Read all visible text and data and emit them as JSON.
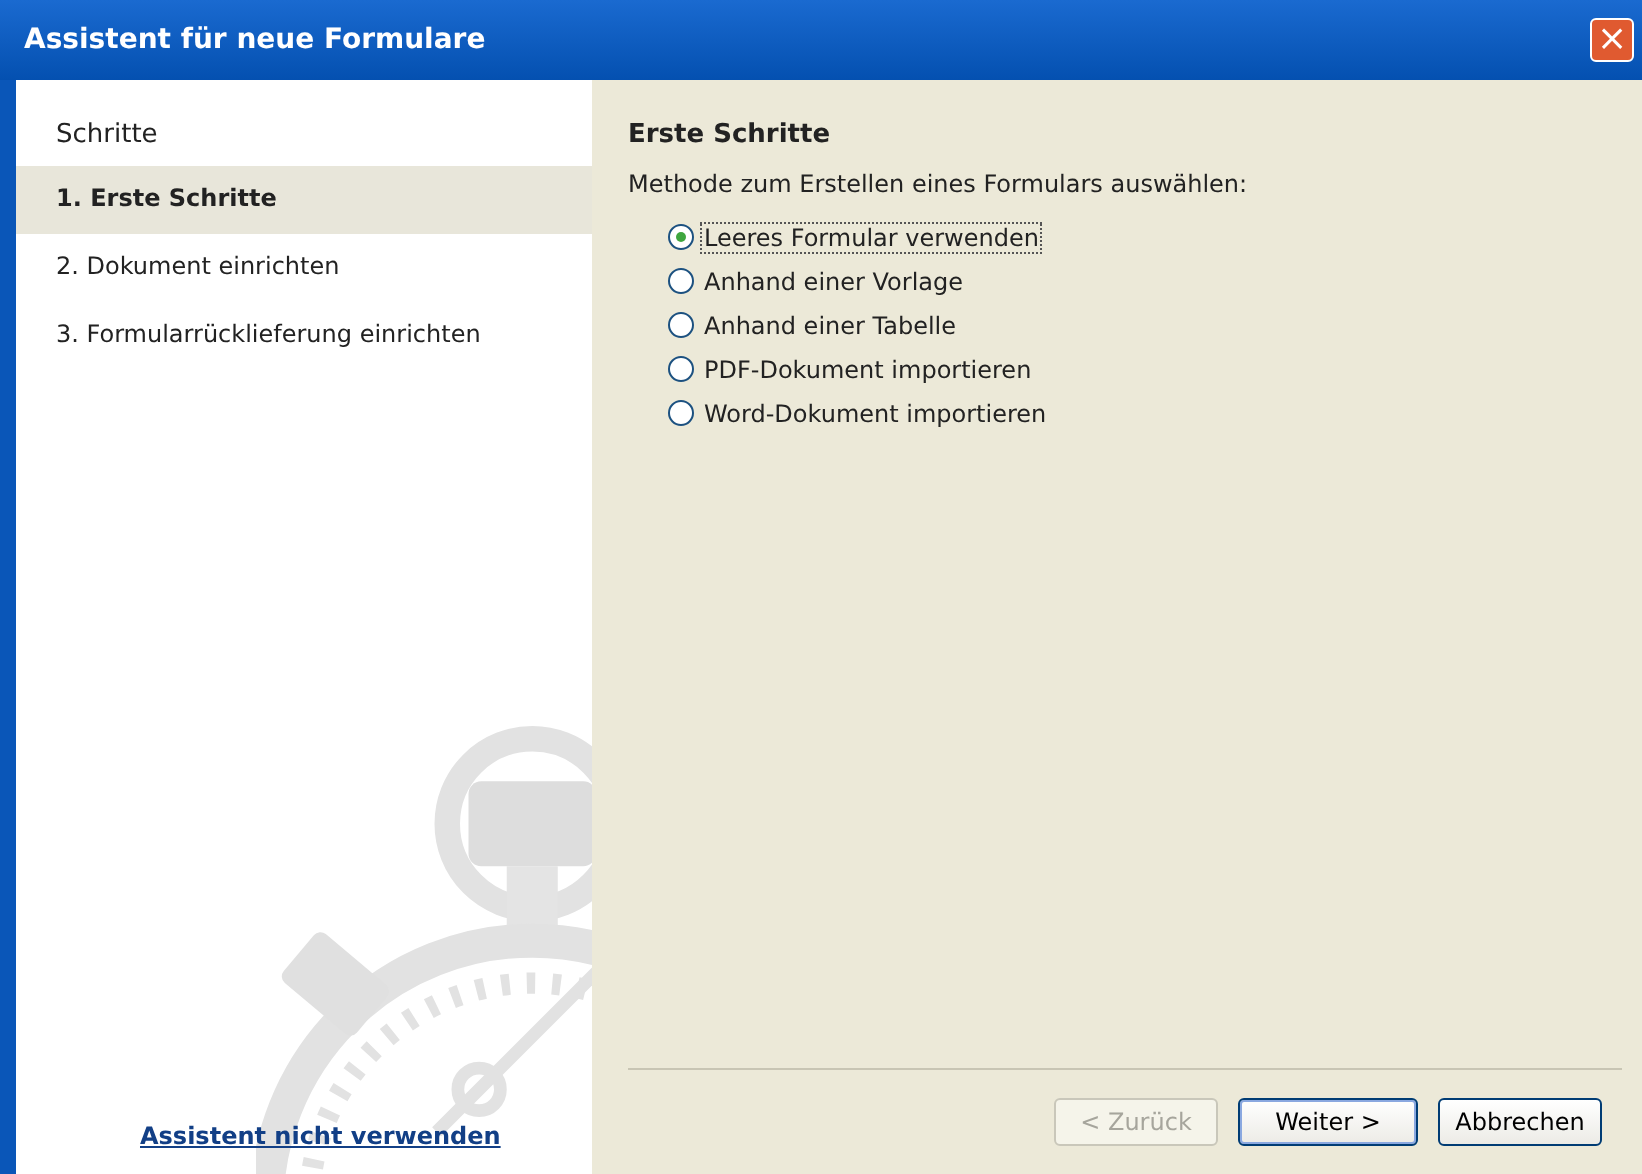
{
  "window": {
    "title": "Assistent für neue Formulare",
    "close": "×"
  },
  "sidebar": {
    "title": "Schritte",
    "items": [
      {
        "label": "1. Erste Schritte",
        "selected": true
      },
      {
        "label": "2. Dokument einrichten",
        "selected": false
      },
      {
        "label": "3. Formularrücklieferung einrichten",
        "selected": false
      }
    ],
    "link": "Assistent nicht verwenden"
  },
  "content": {
    "heading": "Erste Schritte",
    "prompt": "Methode zum Erstellen eines Formulars auswählen:",
    "options": [
      {
        "label": "Leeres Formular verwenden",
        "selected": true
      },
      {
        "label": "Anhand einer Vorlage",
        "selected": false
      },
      {
        "label": "Anhand einer Tabelle",
        "selected": false
      },
      {
        "label": "PDF-Dokument importieren",
        "selected": false
      },
      {
        "label": "Word-Dokument importieren",
        "selected": false
      }
    ]
  },
  "buttons": [
    {
      "label": "< Zurück",
      "disabled": true,
      "default": false
    },
    {
      "label": "Weiter >",
      "disabled": false,
      "default": true
    },
    {
      "label": "Abbrechen",
      "disabled": false,
      "default": false
    }
  ]
}
